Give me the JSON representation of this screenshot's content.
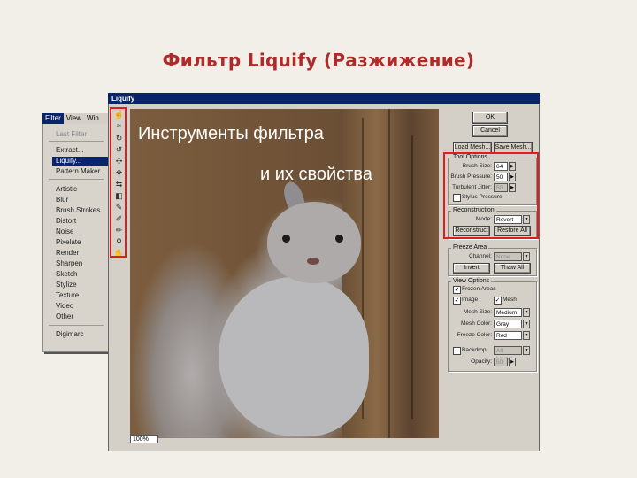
{
  "slide": {
    "title": "Фильтр Liquify (Разжижение)"
  },
  "menu": {
    "bar": [
      "Filter",
      "View",
      "Win"
    ],
    "items": [
      "Last Filter",
      "Extract...",
      "Liquify...",
      "Pattern Maker...",
      "Artistic",
      "Blur",
      "Brush Strokes",
      "Distort",
      "Noise",
      "Pixelate",
      "Render",
      "Sharpen",
      "Sketch",
      "Stylize",
      "Texture",
      "Video",
      "Other",
      "Digimarc"
    ]
  },
  "dialog": {
    "title": "Liquify",
    "overlay_line1": "Инструменты фильтра",
    "overlay_line2": "и их свойства",
    "zoom": "100%",
    "tools": [
      "warp-tool-icon",
      "turbulence-tool-icon",
      "twirl-cw-tool-icon",
      "twirl-ccw-tool-icon",
      "pucker-tool-icon",
      "bloat-tool-icon",
      "shift-pixels-tool-icon",
      "reflection-tool-icon",
      "reconstruct-tool-icon",
      "freeze-tool-icon",
      "thaw-tool-icon",
      "zoom-tool-icon",
      "hand-tool-icon"
    ]
  },
  "panel": {
    "ok": "OK",
    "cancel": "Cancel",
    "load_mesh": "Load Mesh...",
    "save_mesh": "Save Mesh...",
    "tool_options": {
      "title": "Tool Options",
      "brush_size_label": "Brush Size:",
      "brush_size": "64",
      "brush_pressure_label": "Brush Pressure:",
      "brush_pressure": "50",
      "turbulent_jitter_label": "Turbulent Jitter:",
      "turbulent_jitter": "50",
      "stylus_pressure": "Stylus Pressure"
    },
    "reconstruction": {
      "title": "Reconstruction",
      "mode_label": "Mode:",
      "mode": "Revert",
      "reconstruct": "Reconstruct",
      "restore_all": "Restore All"
    },
    "freeze_area": {
      "title": "Freeze Area",
      "channel_label": "Channel:",
      "channel": "None",
      "invert": "Invert",
      "thaw_all": "Thaw All"
    },
    "view_options": {
      "title": "View Options",
      "show_frozen": "Frozen Areas",
      "show_mesh": "Mesh",
      "show_image": "Image",
      "mesh_size_label": "Mesh Size:",
      "mesh_size": "Medium",
      "mesh_color_label": "Mesh Color:",
      "mesh_color": "Gray",
      "freeze_color_label": "Freeze Color:",
      "freeze_color": "Red",
      "backdrop": "Backdrop",
      "backdrop_value": "All Layers",
      "opacity_label": "Opacity:",
      "opacity": "50"
    }
  },
  "colors": {
    "highlight": "#e01e1e",
    "title": "#b02a2a",
    "titlebar": "#0a246a"
  }
}
